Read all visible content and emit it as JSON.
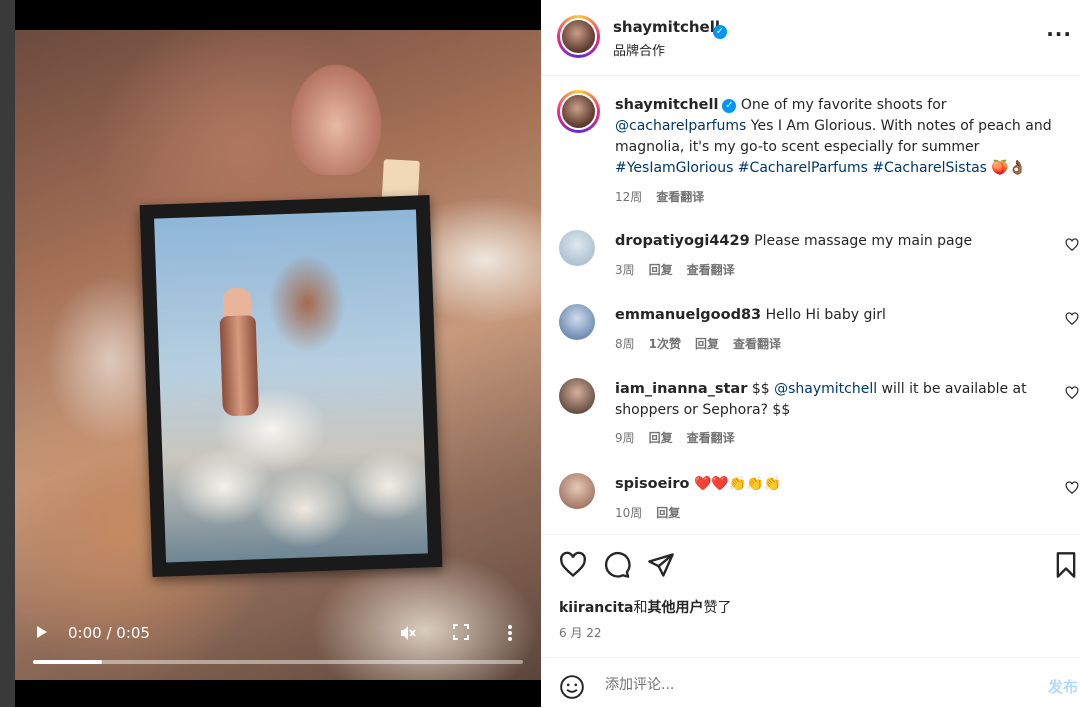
{
  "video": {
    "time": "0:00 / 0:05",
    "progress_fraction": 0.14
  },
  "header": {
    "username": "shaymitchell",
    "verified": true,
    "subtitle": "品牌合作",
    "more": "···"
  },
  "caption": {
    "username": "shaymitchell",
    "text_1": "One of my favorite shoots for ",
    "mention": "@cacharelparfums",
    "text_2": " Yes I Am Glorious. With notes of peach and magnolia, it's my go-to scent especially for summer ",
    "hashtags": "#YesIamGlorious #CacharelParfums #CacharelSistas",
    "emoji": "🍑👌🏾",
    "age": "12周",
    "translate": "查看翻译"
  },
  "comments": [
    {
      "username": "dropatiyogi4429",
      "text": "Please massage my main page",
      "age": "3周",
      "likes": "",
      "reply": "回复",
      "translate": "查看翻译"
    },
    {
      "username": "emmanuelgood83",
      "text": "Hello Hi baby girl",
      "age": "8周",
      "likes": "1次赞",
      "reply": "回复",
      "translate": "查看翻译"
    },
    {
      "username": "iam_inanna_star",
      "text_1": "$$ ",
      "mention": "@shaymitchell",
      "text_2": " will it be available at shoppers or Sephora? $$",
      "age": "9周",
      "reply": "回复",
      "translate": "查看翻译"
    },
    {
      "username": "spisoeiro",
      "text": "❤️❤️👏👏👏",
      "age": "10周",
      "reply": "回复"
    }
  ],
  "likes_line": {
    "user": "kiirancita",
    "connector": "和",
    "others": "其他用户",
    "suffix": "赞了"
  },
  "date": "6 月 22",
  "composer": {
    "placeholder": "添加评论...",
    "post_label": "发布"
  },
  "colors": {
    "link": "#00376b",
    "verified": "#0095f6",
    "post_disabled": "#b3dbff",
    "muted": "#737373"
  }
}
